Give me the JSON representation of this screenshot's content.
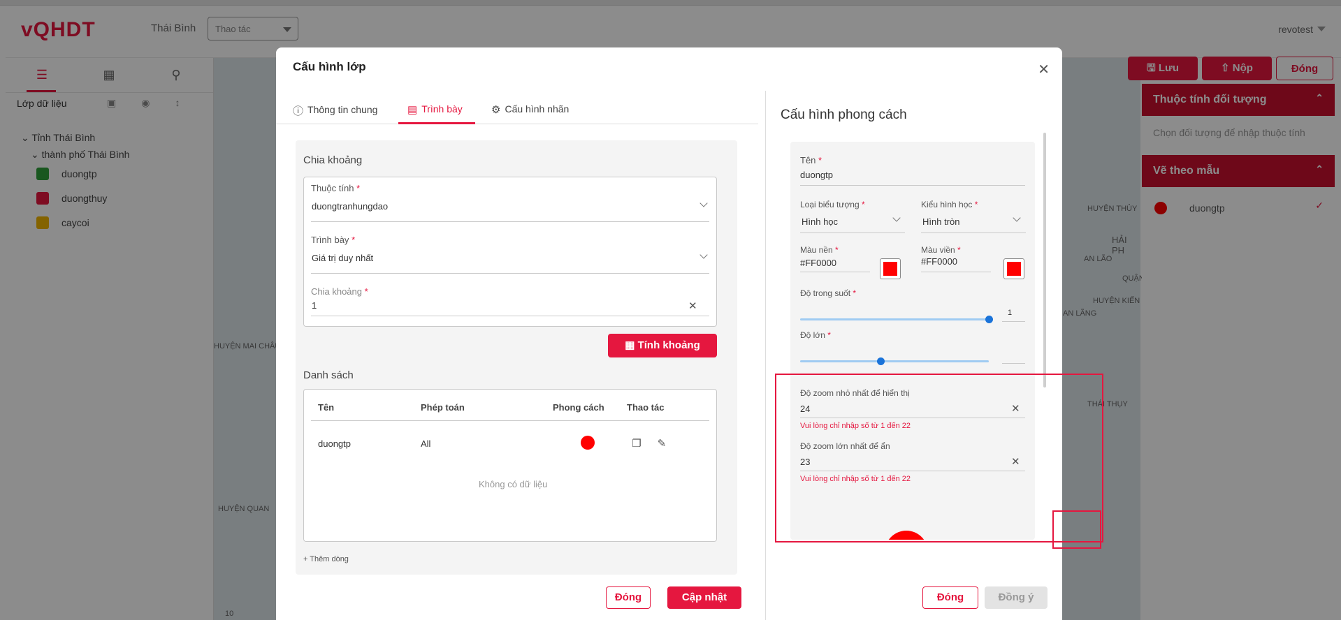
{
  "app": {
    "logo": "vQHDT",
    "region": "Thái Bình",
    "action_select": "Thao tác",
    "user": "revotest"
  },
  "left_panel": {
    "title": "Lớp dữ liệu",
    "tree": {
      "province": "Tỉnh Thái Bình",
      "city": "thành phố Thái Bình"
    },
    "layers": [
      {
        "label": "duongtp",
        "color": "#2e9e3a"
      },
      {
        "label": "duongthuy",
        "color": "#e5173f"
      },
      {
        "label": "caycoi",
        "color": "#f0b400"
      }
    ]
  },
  "toolbar": {
    "save_label": "Lưu",
    "submit_label": "Nộp",
    "close_label": "Đóng"
  },
  "right_panel": {
    "attr_title": "Thuộc tính đối tượng",
    "attr_hint": "Chọn đối tượng để nhập thuộc tính",
    "draw_title": "Vẽ theo mẫu",
    "draw_item": "duongtp"
  },
  "map_labels": {
    "l1": "HUYỆN MAI CHÂU",
    "l2": "HUYỆN QUAN",
    "l3": "HUYỆN THỦY",
    "l4": "HẢI PH",
    "l5": "AN LÃO",
    "l6": "QUẬN",
    "l7": "HUYỆN KIẾN",
    "l8": "AN LÃNG",
    "l9": "THÁI THỤY",
    "l10": "10"
  },
  "modal": {
    "title": "Cấu hình lớp",
    "tabs": [
      {
        "label": "Thông tin chung"
      },
      {
        "label": "Trình bày"
      },
      {
        "label": "Cấu hình nhãn"
      }
    ],
    "chia_khoang_section": "Chia khoảng",
    "thuoc_tinh_label": "Thuộc tính",
    "thuoc_tinh_value": "duongtranhungdao",
    "trinh_bay_label": "Trình bày",
    "trinh_bay_value": "Giá trị duy nhất",
    "chia_khoang_label": "Chia khoảng",
    "chia_khoang_value": "1",
    "tinh_khoang_button": "Tính khoảng",
    "danh_sach_section": "Danh sách",
    "table_headers": {
      "ten": "Tên",
      "phep_toan": "Phép toán",
      "phong_cach": "Phong cách",
      "thao_tac": "Thao tác"
    },
    "table_rows": [
      {
        "ten": "duongtp",
        "phep_toan": "All",
        "style_color": "#ff0000"
      }
    ],
    "empty_text": "Không có dữ liệu",
    "add_row": "+ Thêm dòng",
    "close_button": "Đóng",
    "update_button": "Cập nhật"
  },
  "style_config": {
    "title": "Cấu hình phong cách",
    "ten_label": "Tên",
    "ten_value": "duongtp",
    "loai_bieu_tuong_label": "Loại biểu tượng",
    "loai_bieu_tuong_value": "Hình học",
    "kieu_hinh_hoc_label": "Kiểu hình học",
    "kieu_hinh_hoc_value": "Hình tròn",
    "mau_nen_label": "Màu nền",
    "mau_nen_value": "#FF0000",
    "mau_vien_label": "Màu viền",
    "mau_vien_value": "#FF0000",
    "do_trong_suot_label": "Độ trong suốt",
    "do_trong_suot_value": "1",
    "do_trong_suot_fraction": 1.0,
    "do_lon_label": "Độ lớn",
    "do_lon_fraction": 0.5,
    "zoom_min_label": "Độ zoom nhỏ nhất để hiển thị",
    "zoom_min_value": "24",
    "zoom_min_error": "Vui lòng chỉ nhập số từ 1 đến 22",
    "zoom_max_label": "Độ zoom lớn nhất để ẩn",
    "zoom_max_value": "23",
    "zoom_max_error": "Vui lòng chỉ nhập số từ 1 đến 22",
    "close_button": "Đóng",
    "agree_button": "Đồng ý"
  },
  "colors": {
    "brand": "#e5173f",
    "fill": "#ff0000",
    "slider": "#1a73d9"
  }
}
